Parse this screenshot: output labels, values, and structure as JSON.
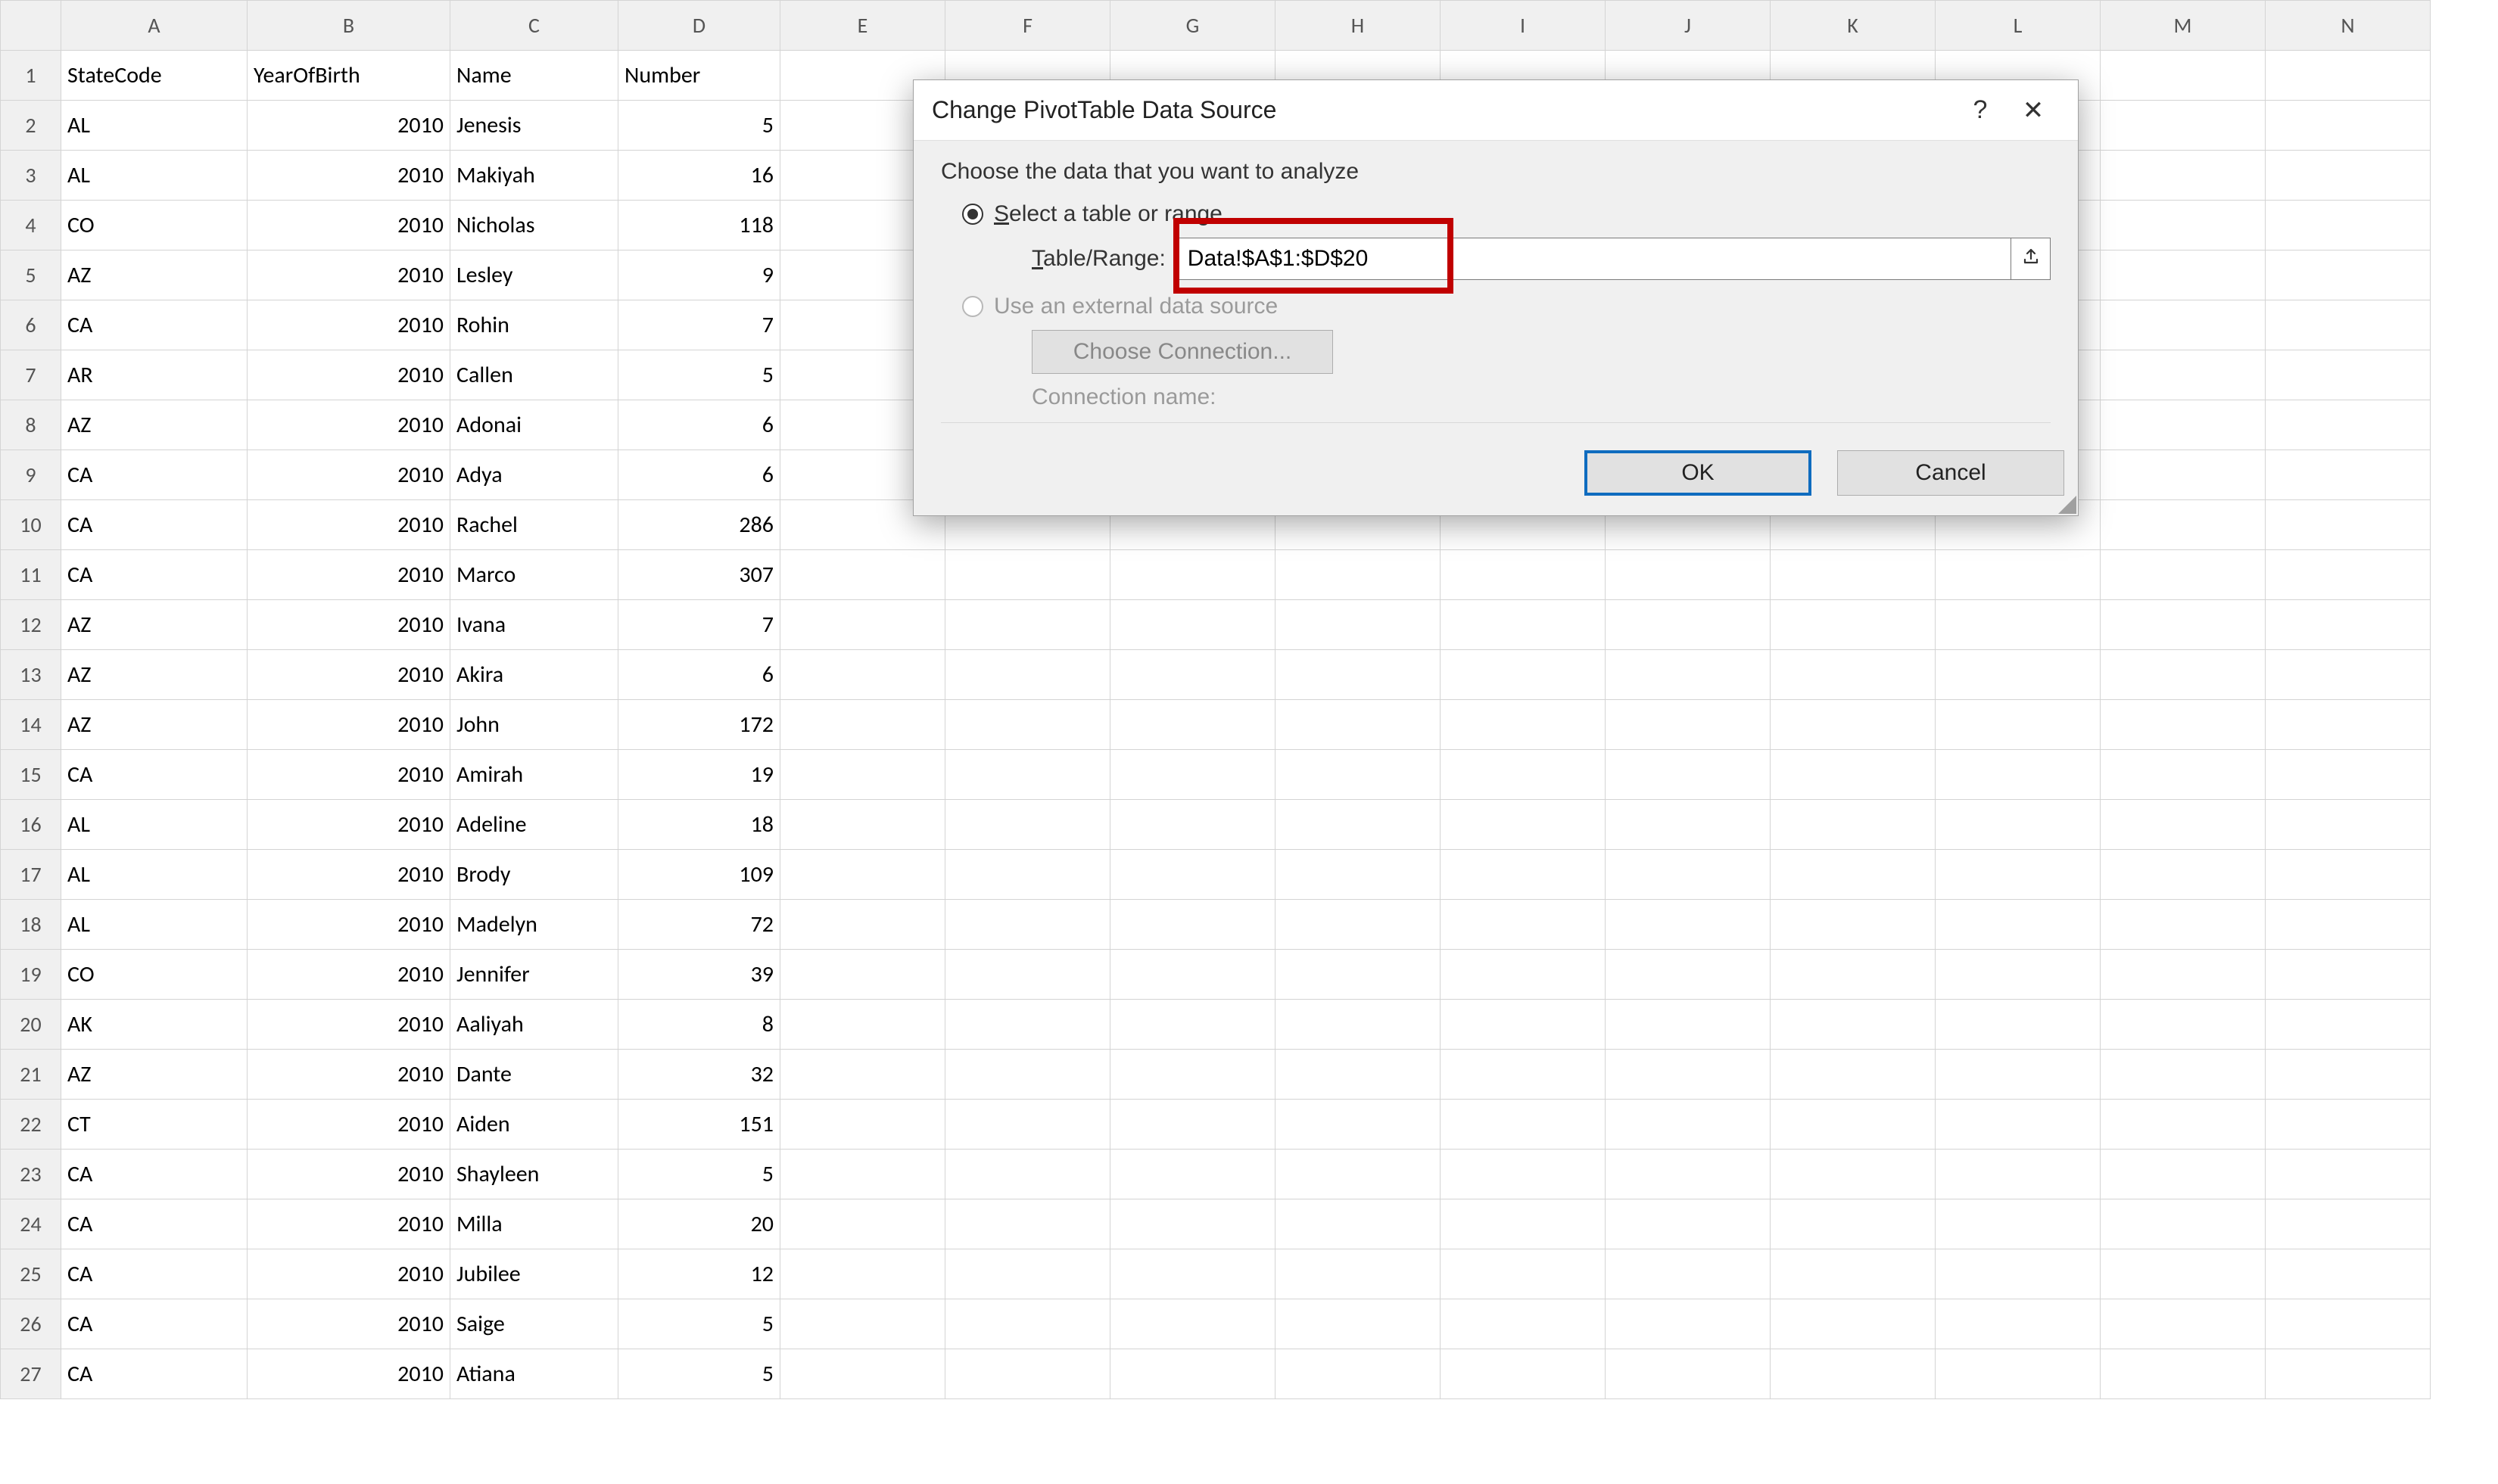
{
  "columns": [
    "A",
    "B",
    "C",
    "D",
    "E",
    "F",
    "G",
    "H",
    "I",
    "J",
    "K",
    "L",
    "M",
    "N"
  ],
  "headers": {
    "A": "StateCode",
    "B": "YearOfBirth",
    "C": "Name",
    "D": "Number"
  },
  "rows": [
    {
      "n": 1,
      "A": "StateCode",
      "B": "YearOfBirth",
      "C": "Name",
      "D": "Number"
    },
    {
      "n": 2,
      "A": "AL",
      "B": 2010,
      "C": "Jenesis",
      "D": 5
    },
    {
      "n": 3,
      "A": "AL",
      "B": 2010,
      "C": "Makiyah",
      "D": 16
    },
    {
      "n": 4,
      "A": "CO",
      "B": 2010,
      "C": "Nicholas",
      "D": 118
    },
    {
      "n": 5,
      "A": "AZ",
      "B": 2010,
      "C": "Lesley",
      "D": 9
    },
    {
      "n": 6,
      "A": "CA",
      "B": 2010,
      "C": "Rohin",
      "D": 7
    },
    {
      "n": 7,
      "A": "AR",
      "B": 2010,
      "C": "Callen",
      "D": 5
    },
    {
      "n": 8,
      "A": "AZ",
      "B": 2010,
      "C": "Adonai",
      "D": 6
    },
    {
      "n": 9,
      "A": "CA",
      "B": 2010,
      "C": "Adya",
      "D": 6
    },
    {
      "n": 10,
      "A": "CA",
      "B": 2010,
      "C": "Rachel",
      "D": 286
    },
    {
      "n": 11,
      "A": "CA",
      "B": 2010,
      "C": "Marco",
      "D": 307
    },
    {
      "n": 12,
      "A": "AZ",
      "B": 2010,
      "C": "Ivana",
      "D": 7
    },
    {
      "n": 13,
      "A": "AZ",
      "B": 2010,
      "C": "Akira",
      "D": 6
    },
    {
      "n": 14,
      "A": "AZ",
      "B": 2010,
      "C": "John",
      "D": 172
    },
    {
      "n": 15,
      "A": "CA",
      "B": 2010,
      "C": "Amirah",
      "D": 19
    },
    {
      "n": 16,
      "A": "AL",
      "B": 2010,
      "C": "Adeline",
      "D": 18
    },
    {
      "n": 17,
      "A": "AL",
      "B": 2010,
      "C": "Brody",
      "D": 109
    },
    {
      "n": 18,
      "A": "AL",
      "B": 2010,
      "C": "Madelyn",
      "D": 72
    },
    {
      "n": 19,
      "A": "CO",
      "B": 2010,
      "C": "Jennifer",
      "D": 39
    },
    {
      "n": 20,
      "A": "AK",
      "B": 2010,
      "C": "Aaliyah",
      "D": 8
    },
    {
      "n": 21,
      "A": "AZ",
      "B": 2010,
      "C": "Dante",
      "D": 32
    },
    {
      "n": 22,
      "A": "CT",
      "B": 2010,
      "C": "Aiden",
      "D": 151
    },
    {
      "n": 23,
      "A": "CA",
      "B": 2010,
      "C": "Shayleen",
      "D": 5
    },
    {
      "n": 24,
      "A": "CA",
      "B": 2010,
      "C": "Milla",
      "D": 20
    },
    {
      "n": 25,
      "A": "CA",
      "B": 2010,
      "C": "Jubilee",
      "D": 12
    },
    {
      "n": 26,
      "A": "CA",
      "B": 2010,
      "C": "Saige",
      "D": 5
    },
    {
      "n": 27,
      "A": "CA",
      "B": 2010,
      "C": "Atiana",
      "D": 5
    }
  ],
  "dialog": {
    "title": "Change PivotTable Data Source",
    "help_symbol": "?",
    "close_symbol": "✕",
    "instruction": "Choose the data that you want to analyze",
    "opt_select_pre": "",
    "opt_select_key": "S",
    "opt_select_post": "elect a table or range",
    "range_label_key": "T",
    "range_label_post": "able/Range:",
    "range_value": "Data!$A$1:$D$20",
    "opt_external": "Use an external data source",
    "choose_connection": "Choose Connection...",
    "connection_name_label": "Connection name:",
    "ok": "OK",
    "cancel": "Cancel"
  }
}
